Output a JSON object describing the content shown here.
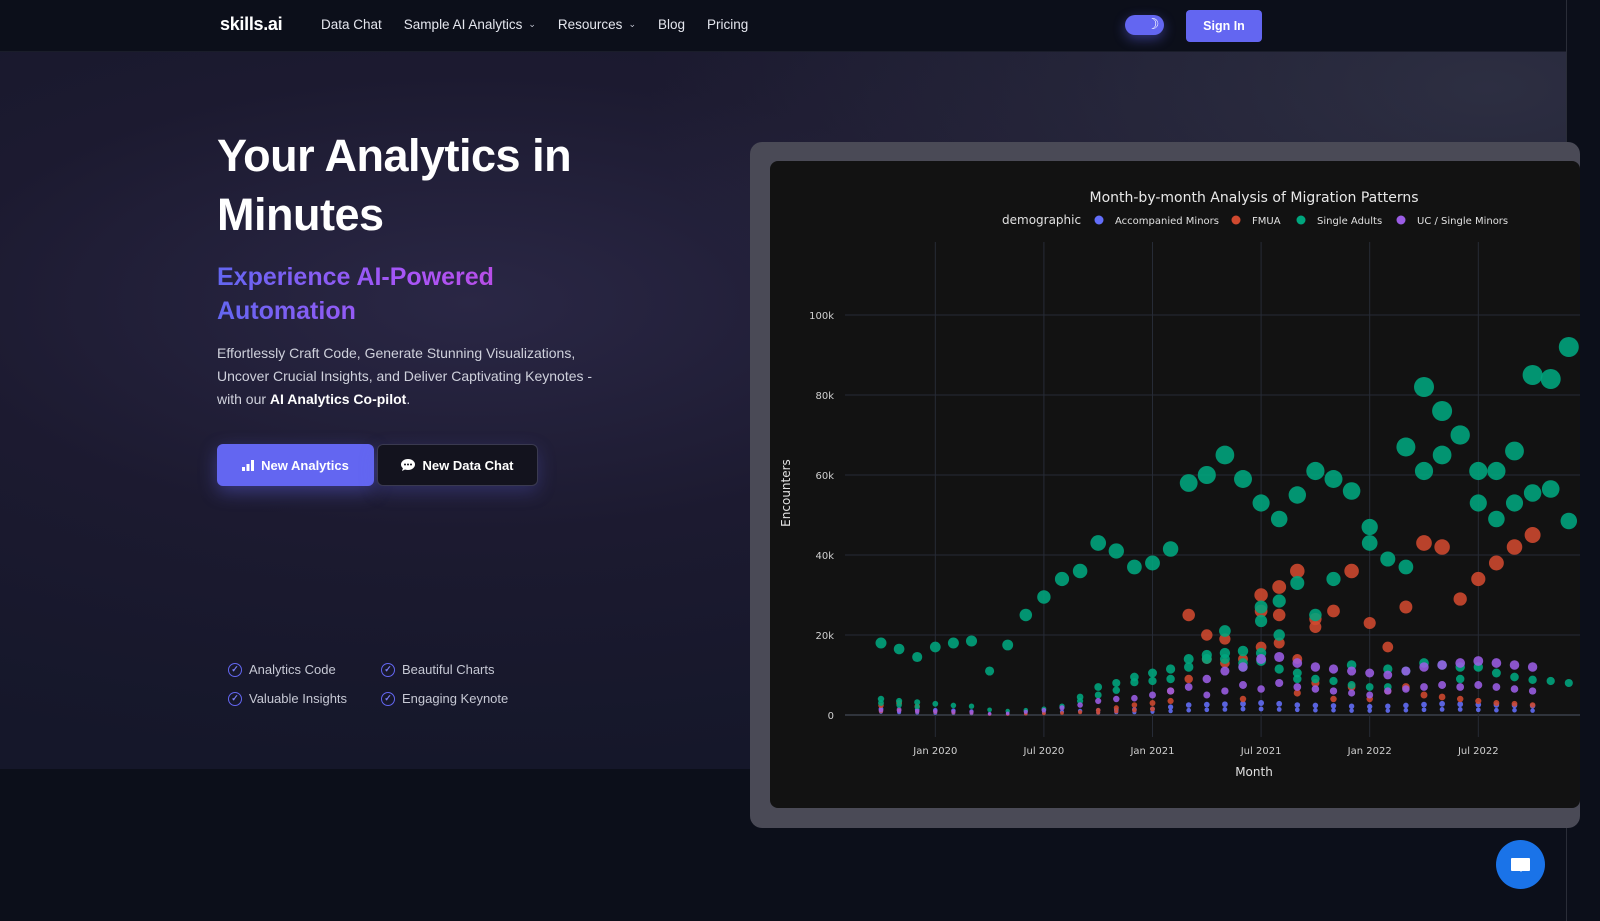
{
  "nav": {
    "logo": "skills.ai",
    "links": [
      {
        "label": "Data Chat",
        "dropdown": false
      },
      {
        "label": "Sample AI Analytics",
        "dropdown": true
      },
      {
        "label": "Resources",
        "dropdown": true
      },
      {
        "label": "Blog",
        "dropdown": false
      },
      {
        "label": "Pricing",
        "dropdown": false
      }
    ],
    "theme_toggle_icon": "moon-icon",
    "signin_label": "Sign In"
  },
  "hero": {
    "title": "Your Analytics in Minutes",
    "subtitle": "Experience AI-Powered Automation",
    "description_pre": "Effortlessly Craft Code, Generate Stunning Visualizations, Uncover Crucial Insights, and Deliver Captivating Keynotes - with our ",
    "description_bold": "AI Analytics Co-pilot",
    "description_post": ".",
    "primary_button": {
      "label": "New Analytics",
      "icon": "bar-chart-icon"
    },
    "secondary_button": {
      "label": "New Data Chat",
      "icon": "chat-bubble-icon"
    },
    "features": [
      "Analytics Code",
      "Beautiful Charts",
      "Valuable Insights",
      "Engaging Keynote"
    ]
  },
  "colors": {
    "accent": "#6366f1",
    "accompanied_minors": "#636efa",
    "fmua": "#d0492f",
    "single_adults": "#00a67e",
    "uc_single_minors": "#9b5de5",
    "chat_widget": "#1a73e8"
  },
  "chart_data": {
    "type": "scatter",
    "title": "Month-by-month Analysis of Migration Patterns",
    "legend_title": "demographic",
    "legend_position": "top",
    "xlabel": "Month",
    "ylabel": "Encounters",
    "x_ticks": [
      "Jan 2020",
      "Jul 2020",
      "Jan 2021",
      "Jul 2021",
      "Jan 2022",
      "Jul 2022"
    ],
    "y_ticks": [
      "0",
      "20k",
      "40k",
      "60k",
      "80k",
      "100k"
    ],
    "y_tick_values": [
      0,
      20000,
      40000,
      60000,
      80000,
      100000
    ],
    "ylim": [
      0,
      118000
    ],
    "x_start": "2019-10",
    "x_end": "2022-11",
    "grid": true,
    "marker_size_by_value": true,
    "months": [
      "2019-10",
      "2019-11",
      "2019-12",
      "2020-01",
      "2020-02",
      "2020-03",
      "2020-04",
      "2020-05",
      "2020-06",
      "2020-07",
      "2020-08",
      "2020-09",
      "2020-10",
      "2020-11",
      "2020-12",
      "2021-01",
      "2021-02",
      "2021-03",
      "2021-04",
      "2021-05",
      "2021-06",
      "2021-07",
      "2021-08",
      "2021-09",
      "2021-10",
      "2021-11",
      "2021-12",
      "2022-01",
      "2022-02",
      "2022-03",
      "2022-04",
      "2022-05",
      "2022-06",
      "2022-07",
      "2022-08",
      "2022-09",
      "2022-10"
    ],
    "series": [
      {
        "name": "Accompanied Minors",
        "color": "#636efa",
        "points": [
          [
            0,
            [
              1500,
              800
            ]
          ],
          [
            1,
            [
              1400,
              700
            ]
          ],
          [
            2,
            [
              1300,
              600
            ]
          ],
          [
            3,
            [
              1200,
              500
            ]
          ],
          [
            4,
            [
              1100,
              500
            ]
          ],
          [
            5,
            [
              900,
              400
            ]
          ],
          [
            6,
            [
              300
            ]
          ],
          [
            7,
            [
              300
            ]
          ],
          [
            8,
            [
              400
            ]
          ],
          [
            9,
            [
              600
            ]
          ],
          [
            10,
            [
              800
            ]
          ],
          [
            11,
            [
              1000
            ]
          ],
          [
            12,
            [
              1200,
              600
            ]
          ],
          [
            13,
            [
              1300,
              700
            ]
          ],
          [
            14,
            [
              1400,
              700
            ]
          ],
          [
            15,
            [
              1500,
              800
            ]
          ],
          [
            16,
            [
              2000,
              1000
            ]
          ],
          [
            17,
            [
              2500,
              1200
            ]
          ],
          [
            18,
            [
              2600,
              1300
            ]
          ],
          [
            19,
            [
              2700,
              1400
            ]
          ],
          [
            20,
            [
              2800,
              1500
            ]
          ],
          [
            21,
            [
              3000,
              1500
            ]
          ],
          [
            22,
            [
              2800,
              1400
            ]
          ],
          [
            23,
            [
              2500,
              1300
            ]
          ],
          [
            24,
            [
              2400,
              1200
            ]
          ],
          [
            25,
            [
              2300,
              1200
            ]
          ],
          [
            26,
            [
              2200,
              1100
            ]
          ],
          [
            27,
            [
              2100,
              1100
            ]
          ],
          [
            28,
            [
              2200,
              1100
            ]
          ],
          [
            29,
            [
              2400,
              1200
            ]
          ],
          [
            30,
            [
              2600,
              1300
            ]
          ],
          [
            31,
            [
              2800,
              1400
            ]
          ],
          [
            32,
            [
              2700,
              1400
            ]
          ],
          [
            33,
            [
              2600,
              1300
            ]
          ],
          [
            34,
            [
              2500,
              1200
            ]
          ],
          [
            35,
            [
              2400,
              1200
            ]
          ],
          [
            36,
            [
              2300,
              1100
            ]
          ]
        ]
      },
      {
        "name": "FMUA",
        "color": "#d0492f",
        "points": [
          [
            0,
            [
              2400,
              1000
            ]
          ],
          [
            1,
            [
              3000,
              1200
            ]
          ],
          [
            2,
            [
              2200,
              900
            ]
          ],
          [
            3,
            [
              800
            ]
          ],
          [
            4,
            [
              700
            ]
          ],
          [
            5,
            [
              600
            ]
          ],
          [
            6,
            [
              200
            ]
          ],
          [
            7,
            [
              200
            ]
          ],
          [
            8,
            [
              300
            ]
          ],
          [
            9,
            [
              400
            ]
          ],
          [
            10,
            [
              500
            ]
          ],
          [
            11,
            [
              700
            ]
          ],
          [
            12,
            [
              1200,
              600
            ]
          ],
          [
            13,
            [
              1800,
              900
            ]
          ],
          [
            14,
            [
              2500,
              1200
            ]
          ],
          [
            15,
            [
              3000,
              1500
            ]
          ],
          [
            16,
            [
              6000,
              3500
            ]
          ],
          [
            17,
            [
              25000,
              9000
            ]
          ],
          [
            18,
            [
              20000,
              14000
            ]
          ],
          [
            19,
            [
              19000,
              13000
            ]
          ],
          [
            20,
            [
              14000,
              4000
            ]
          ],
          [
            21,
            [
              30000,
              17000,
              26000
            ]
          ],
          [
            22,
            [
              32000,
              18000,
              25000
            ]
          ],
          [
            23,
            [
              36000,
              14000,
              5500
            ]
          ],
          [
            24,
            [
              24000,
              22000,
              8000
            ]
          ],
          [
            25,
            [
              26000,
              4000
            ]
          ],
          [
            26,
            [
              36000,
              7000
            ]
          ],
          [
            27,
            [
              23000,
              4000
            ]
          ],
          [
            28,
            [
              17000,
              6000
            ]
          ],
          [
            29,
            [
              27000,
              7000
            ]
          ],
          [
            30,
            [
              43000,
              5000
            ]
          ],
          [
            31,
            [
              42000,
              4500
            ]
          ],
          [
            32,
            [
              29000,
              4000
            ]
          ],
          [
            33,
            [
              34000,
              3500
            ]
          ],
          [
            34,
            [
              38000,
              3000
            ]
          ],
          [
            35,
            [
              42000,
              2800
            ]
          ],
          [
            36,
            [
              45000,
              2500
            ]
          ]
        ]
      },
      {
        "name": "Single Adults",
        "color": "#00a67e",
        "points": [
          [
            0,
            [
              18000,
              4000,
              3000
            ]
          ],
          [
            1,
            [
              16500,
              3500,
              2500
            ]
          ],
          [
            2,
            [
              14500,
              3200,
              2000
            ]
          ],
          [
            3,
            [
              17000,
              2800
            ]
          ],
          [
            4,
            [
              18000,
              2400
            ]
          ],
          [
            5,
            [
              18500,
              2200
            ]
          ],
          [
            6,
            [
              11000,
              1300
            ]
          ],
          [
            7,
            [
              17500,
              1000
            ]
          ],
          [
            8,
            [
              25000,
              1200
            ]
          ],
          [
            9,
            [
              29500,
              1500
            ]
          ],
          [
            10,
            [
              34000,
              2200
            ]
          ],
          [
            11,
            [
              36000,
              3500,
              4500
            ]
          ],
          [
            12,
            [
              43000,
              7000,
              5000
            ]
          ],
          [
            13,
            [
              41000,
              8000,
              6200
            ]
          ],
          [
            14,
            [
              37000,
              9500,
              8200
            ]
          ],
          [
            15,
            [
              38000,
              10500,
              8500
            ]
          ],
          [
            16,
            [
              41500,
              11500,
              9000
            ]
          ],
          [
            17,
            [
              58000,
              14000,
              12000
            ]
          ],
          [
            18,
            [
              60000,
              15000,
              14000
            ]
          ],
          [
            19,
            [
              65000,
              21000,
              15500,
              14000
            ]
          ],
          [
            20,
            [
              59000,
              16000,
              13000,
              12000
            ]
          ],
          [
            21,
            [
              53000,
              27000,
              23500,
              15500,
              13500
            ]
          ],
          [
            22,
            [
              49000,
              28500,
              20000,
              11500
            ]
          ],
          [
            23,
            [
              55000,
              33000,
              10500,
              9000
            ]
          ],
          [
            24,
            [
              61000,
              25000,
              9000
            ]
          ],
          [
            25,
            [
              59000,
              34000,
              8500
            ]
          ],
          [
            26,
            [
              56000,
              12500,
              7500
            ]
          ],
          [
            27,
            [
              47000,
              43000,
              7000
            ]
          ],
          [
            28,
            [
              39000,
              11500,
              7000
            ]
          ],
          [
            29,
            [
              37000,
              67000,
              11000
            ]
          ],
          [
            30,
            [
              82000,
              61000,
              13000
            ]
          ],
          [
            31,
            [
              76000,
              65000,
              12500
            ]
          ],
          [
            32,
            [
              70000,
              12000,
              9000
            ]
          ],
          [
            33,
            [
              61000,
              53000,
              12000
            ]
          ],
          [
            34,
            [
              61000,
              49000,
              10500
            ]
          ],
          [
            35,
            [
              66000,
              53000,
              9500
            ]
          ],
          [
            36,
            [
              85000,
              55500,
              8800
            ]
          ],
          [
            37,
            [
              84000,
              56500,
              8500
            ]
          ],
          [
            38,
            [
              92000,
              48500,
              8000
            ]
          ]
        ]
      },
      {
        "name": "UC / Single Minors",
        "color": "#9b5de5",
        "points": [
          [
            0,
            [
              1200
            ]
          ],
          [
            1,
            [
              1100
            ]
          ],
          [
            2,
            [
              1000
            ]
          ],
          [
            3,
            [
              900
            ]
          ],
          [
            4,
            [
              800
            ]
          ],
          [
            5,
            [
              700
            ]
          ],
          [
            6,
            [
              300
            ]
          ],
          [
            7,
            [
              400
            ]
          ],
          [
            8,
            [
              800
            ]
          ],
          [
            9,
            [
              1200
            ]
          ],
          [
            10,
            [
              1800
            ]
          ],
          [
            11,
            [
              2500
            ]
          ],
          [
            12,
            [
              3500
            ]
          ],
          [
            13,
            [
              4000
            ]
          ],
          [
            14,
            [
              4200
            ]
          ],
          [
            15,
            [
              5000
            ]
          ],
          [
            16,
            [
              6000
            ]
          ],
          [
            17,
            [
              7000
            ]
          ],
          [
            18,
            [
              9000,
              5000
            ]
          ],
          [
            19,
            [
              11000,
              6000
            ]
          ],
          [
            20,
            [
              12000,
              7500
            ]
          ],
          [
            21,
            [
              14000,
              6500
            ]
          ],
          [
            22,
            [
              14500,
              8000
            ]
          ],
          [
            23,
            [
              13000,
              7000
            ]
          ],
          [
            24,
            [
              12000,
              6500
            ]
          ],
          [
            25,
            [
              11500,
              6000
            ]
          ],
          [
            26,
            [
              11000,
              5500
            ]
          ],
          [
            27,
            [
              10500,
              5000
            ]
          ],
          [
            28,
            [
              10000,
              6000
            ]
          ],
          [
            29,
            [
              11000,
              6500
            ]
          ],
          [
            30,
            [
              12000,
              7000
            ]
          ],
          [
            31,
            [
              12500,
              7500
            ]
          ],
          [
            32,
            [
              13000,
              7000
            ]
          ],
          [
            33,
            [
              13500,
              7500
            ]
          ],
          [
            34,
            [
              13000,
              7000
            ]
          ],
          [
            35,
            [
              12500,
              6500
            ]
          ],
          [
            36,
            [
              12000,
              6000
            ]
          ]
        ]
      }
    ]
  }
}
